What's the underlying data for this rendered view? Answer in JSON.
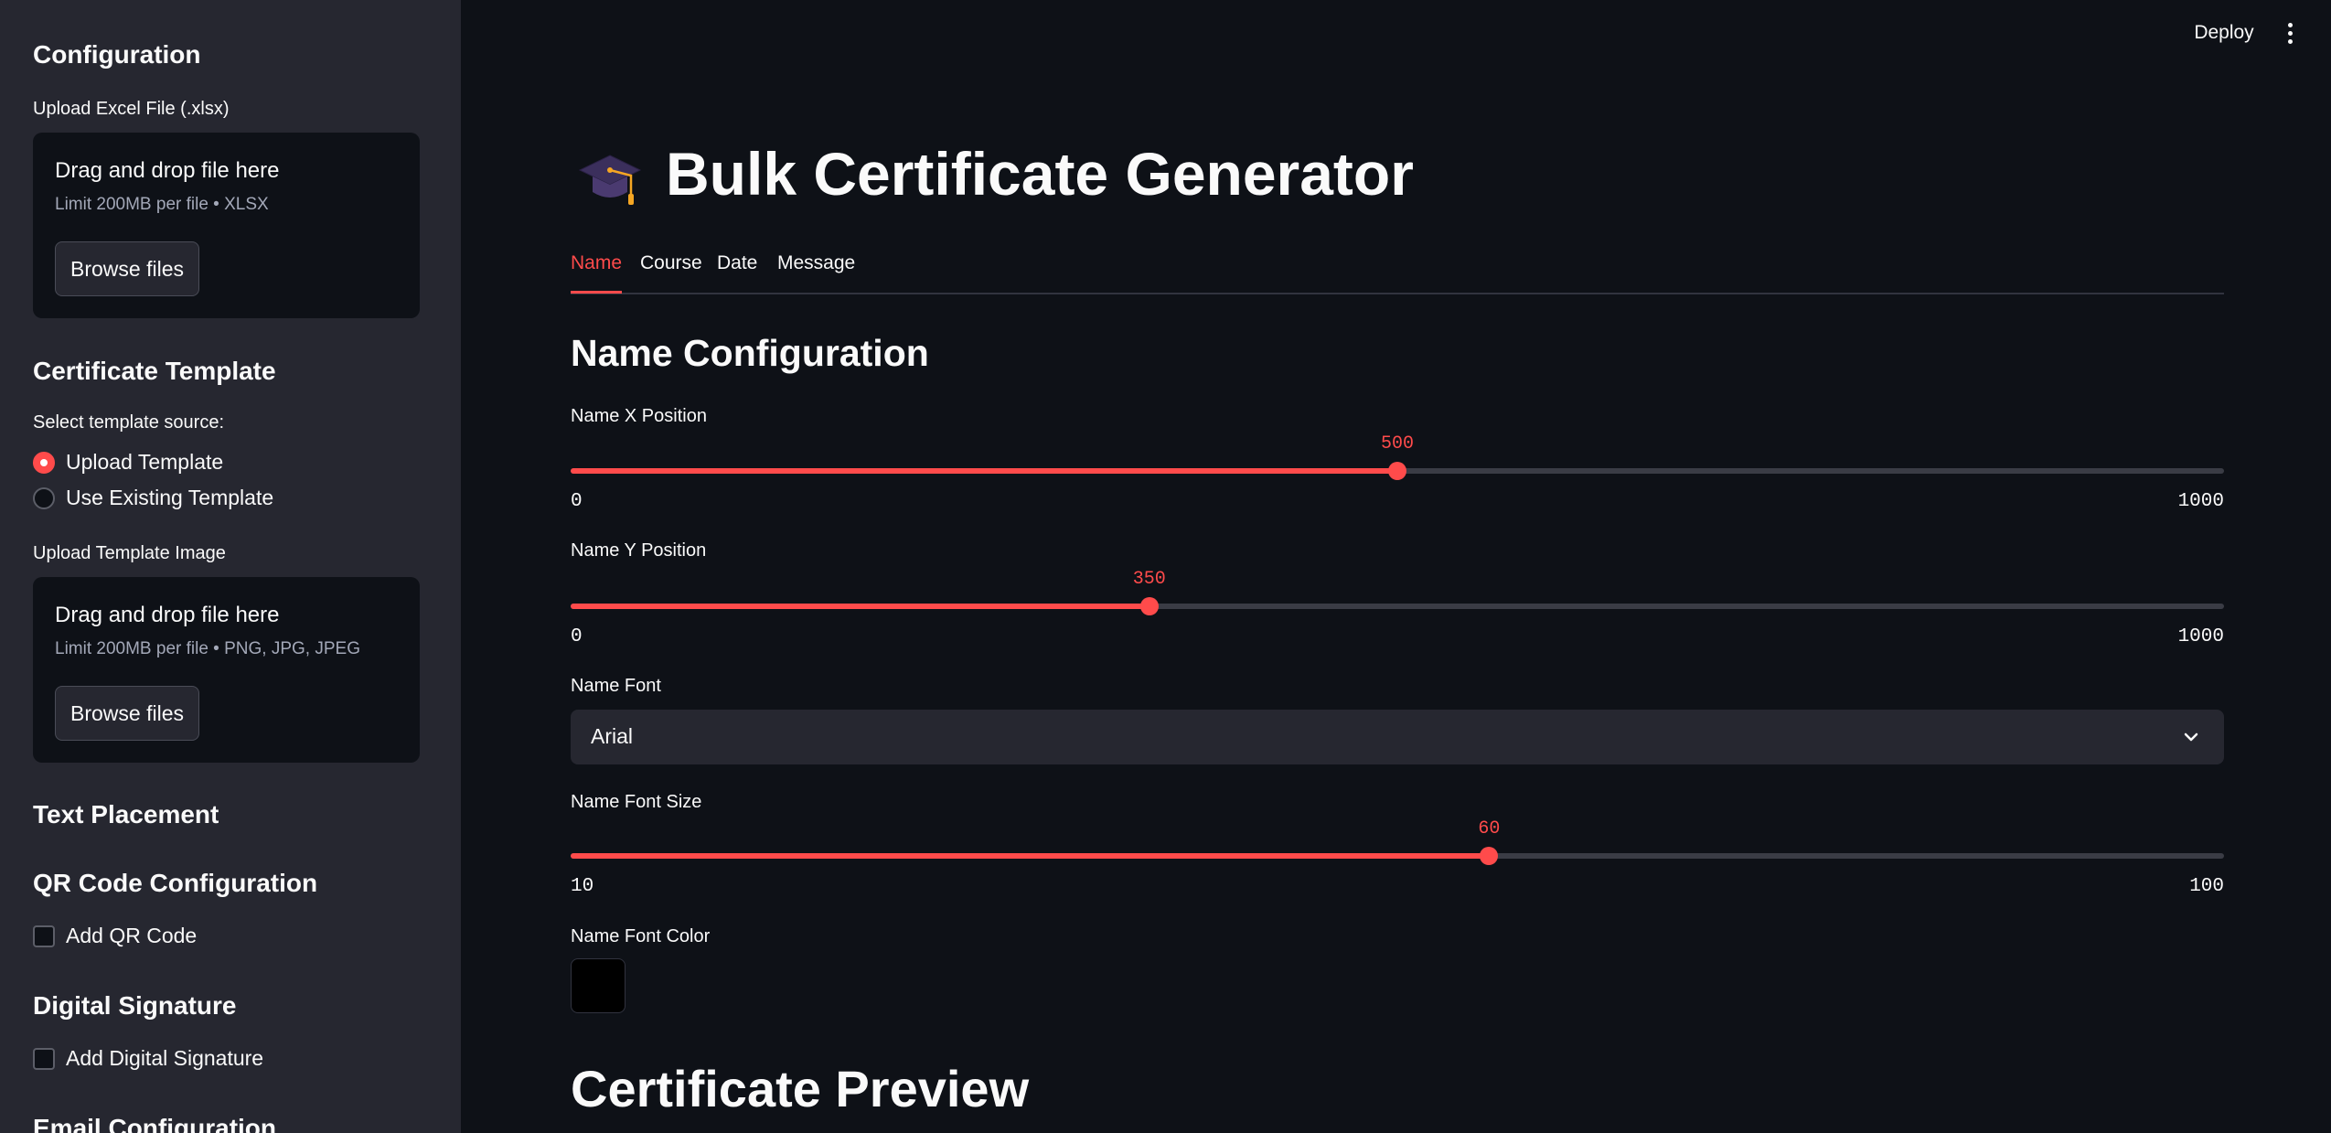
{
  "sidebar": {
    "config_heading": "Configuration",
    "excel_label": "Upload Excel File (.xlsx)",
    "excel_uploader": {
      "title": "Drag and drop file here",
      "limit": "Limit 200MB per file • XLSX",
      "button": "Browse files"
    },
    "template_heading": "Certificate Template",
    "template_source_label": "Select template source:",
    "template_source_options": [
      "Upload Template",
      "Use Existing Template"
    ],
    "template_source_selected": "Upload Template",
    "template_image_label": "Upload Template Image",
    "template_uploader": {
      "title": "Drag and drop file here",
      "limit": "Limit 200MB per file • PNG, JPG, JPEG",
      "button": "Browse files"
    },
    "text_placement_heading": "Text Placement",
    "qr_heading": "QR Code Configuration",
    "qr_checkbox": "Add QR Code",
    "qr_checked": false,
    "signature_heading": "Digital Signature",
    "signature_checkbox": "Add Digital Signature",
    "signature_checked": false,
    "email_heading": "Email Configuration"
  },
  "header": {
    "deploy": "Deploy",
    "menu_icon": "kebab-menu-icon"
  },
  "main": {
    "title_icon": "graduation-cap-icon",
    "title": "Bulk Certificate Generator",
    "tabs": [
      "Name",
      "Course",
      "Date",
      "Message"
    ],
    "active_tab": "Name",
    "section_title": "Name Configuration",
    "x_slider": {
      "label": "Name X Position",
      "value": "500",
      "min": "0",
      "max": "1000"
    },
    "y_slider": {
      "label": "Name Y Position",
      "value": "350",
      "min": "0",
      "max": "1000"
    },
    "font": {
      "label": "Name Font",
      "value": "Arial"
    },
    "size_slider": {
      "label": "Name Font Size",
      "value": "60",
      "min": "10",
      "max": "100"
    },
    "color": {
      "label": "Name Font Color",
      "value": "#000000"
    },
    "preview_title": "Certificate Preview"
  },
  "colors": {
    "accent": "#ff4b4b",
    "background": "#0e1117",
    "sidebar": "#262730"
  }
}
